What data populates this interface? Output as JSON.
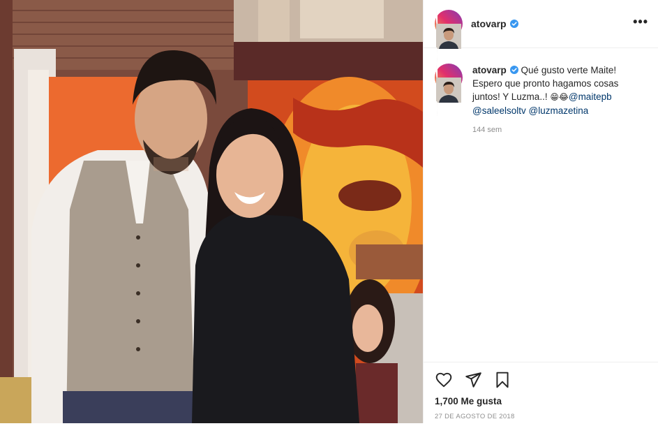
{
  "post": {
    "author": {
      "username": "atovarp",
      "verified": true,
      "avatar_icon": "profile-photo-icon"
    },
    "header": {
      "more_label": "•••"
    },
    "caption": {
      "username": "atovarp",
      "text_1": "Qué gusto verte Maite! Espero que pronto hagamos cosas juntos! Y Luzma..! ",
      "emojis": "😁😂",
      "mention_1": "@maitepb",
      "mention_2": "@saleelsoltv",
      "mention_3": "@luzmazetina",
      "time_ago": "144 sem"
    },
    "actions": {
      "like_icon": "heart-icon",
      "share_icon": "paper-plane-icon",
      "save_icon": "bookmark-icon"
    },
    "likes": "1,700 Me gusta",
    "date": "27 DE AGOSTO DE 2018"
  },
  "colors": {
    "text": "#262626",
    "muted": "#8e8e8e",
    "mention": "#00376b",
    "verified": "#3897f0",
    "border": "#efefef"
  }
}
